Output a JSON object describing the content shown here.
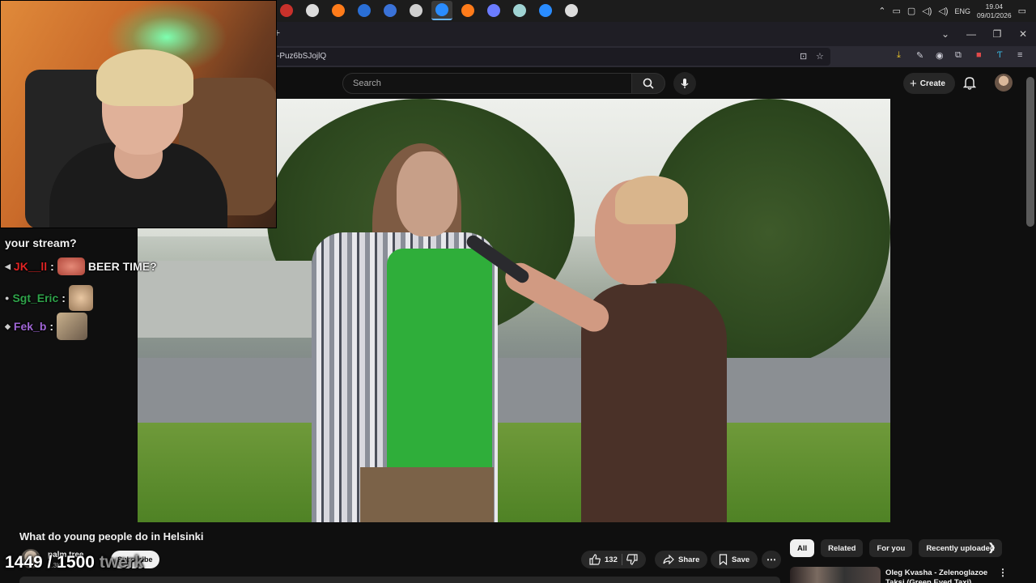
{
  "taskbar": {
    "apps": [
      {
        "icon": "app-icon-red",
        "color": "#c8312b"
      },
      {
        "icon": "obs-icon",
        "color": "#dcdcdc"
      },
      {
        "icon": "firefox-icon",
        "color": "#ff7b1a"
      },
      {
        "icon": "ccleaner-icon",
        "color": "#2a6fd6"
      },
      {
        "icon": "vpn-icon",
        "color": "#3a72d8"
      },
      {
        "icon": "shield-app-icon",
        "color": "#cfcfcf"
      },
      {
        "icon": "firefox-dev-icon",
        "color": "#2a8cff",
        "active": true
      },
      {
        "icon": "firefox-icon",
        "color": "#ff7b1a"
      },
      {
        "icon": "discord-icon",
        "color": "#6b7cff"
      },
      {
        "icon": "files-app-icon",
        "color": "#9fd3d3"
      },
      {
        "icon": "firefox-dev-icon",
        "color": "#2a8cff"
      },
      {
        "icon": "defender-icon",
        "color": "#dcdcdc"
      }
    ],
    "tray": {
      "language": "ENG",
      "time": "19.04",
      "date": "09/01/2026"
    }
  },
  "browser": {
    "url_fragment": "-Puz6bSJojlQ"
  },
  "header": {
    "search_placeholder": "Search",
    "create_label": "Create"
  },
  "chat": {
    "messages": [
      {
        "user": "your stream?",
        "user_color": "#ffffff",
        "text": ""
      },
      {
        "user": "JK__ll",
        "user_color": "#e02424",
        "text": "BEER TIME?"
      },
      {
        "user": "Sgt_Eric",
        "user_color": "#2fa34a",
        "text": ""
      },
      {
        "user": "Fek_b",
        "user_color": "#a066d6",
        "text": ""
      }
    ]
  },
  "video_info": {
    "title": "What do young people do in Helsinki",
    "channel_name": "palm tree",
    "subscribers": "1.3K",
    "subscribe_label": "Subscribe",
    "likes": "132",
    "share_label": "Share",
    "save_label": "Save"
  },
  "goal_overlay": {
    "value": "1449 / 1500",
    "suffix": " twerk"
  },
  "sidebar": {
    "chips": [
      "All",
      "Related",
      "For you",
      "Recently uploaded"
    ],
    "selected_chip": "All",
    "recommendation": {
      "title": "Oleg Kvasha - Zelenoglazoe Taksi (Green Eyed Taxi) (Club"
    }
  }
}
